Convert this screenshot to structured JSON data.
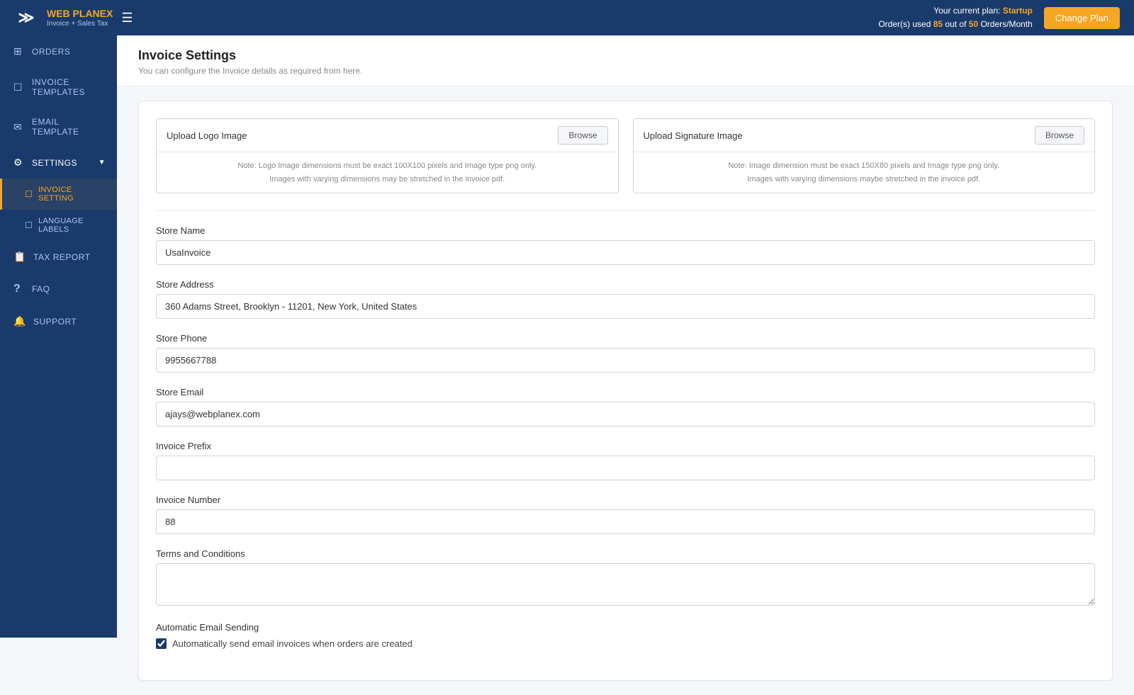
{
  "header": {
    "logo_brand": "WEB PLANEX",
    "logo_sub": "Invoice + Sales Tax",
    "plan_text": "Your current plan:",
    "plan_name": "Startup",
    "orders_used": "85",
    "orders_total": "50",
    "orders_label": "Orders/Month",
    "change_plan_btn": "Change Plan",
    "hamburger": "☰"
  },
  "sidebar": {
    "items": [
      {
        "id": "orders",
        "label": "ORDERS",
        "icon": "⊞"
      },
      {
        "id": "invoice-templates",
        "label": "INVOICE TEMPLATES",
        "icon": "☐"
      },
      {
        "id": "email-template",
        "label": "EMAIL TEMPLATE",
        "icon": "✉"
      },
      {
        "id": "settings",
        "label": "SETTINGS",
        "icon": "⚙",
        "expanded": true,
        "chevron": "▼"
      }
    ],
    "sub_items": [
      {
        "id": "invoice-setting",
        "label": "INVOICE SETTING",
        "icon": "☐",
        "active": true
      },
      {
        "id": "language-labels",
        "label": "LANGUAGE LABELS",
        "icon": "☐"
      }
    ],
    "bottom_items": [
      {
        "id": "tax-report",
        "label": "TAX REPORT",
        "icon": "📋"
      },
      {
        "id": "faq",
        "label": "FAQ",
        "icon": "?"
      },
      {
        "id": "support",
        "label": "SUPPORT",
        "icon": "🔔"
      }
    ]
  },
  "page": {
    "title": "Invoice Settings",
    "subtitle": "You can configure the Invoice details as required from here."
  },
  "upload": {
    "logo_label": "Upload Logo Image",
    "logo_note_line1": "Note: Logo Image dimensions must be exact 100X100 pixels and Image type png only.",
    "logo_note_line2": "Images with varying dimensions may be stretched in the invoice pdf.",
    "logo_browse": "Browse",
    "sig_label": "Upload Signature Image",
    "sig_note_line1": "Note: Image dimension must be exact 150X80 pixels and Image type png only.",
    "sig_note_line2": "Images with varying dimensions maybe stretched in the invoice pdf.",
    "sig_browse": "Browse"
  },
  "form": {
    "store_name_label": "Store Name",
    "store_name_value": "UsaInvoice",
    "store_address_label": "Store Address",
    "store_address_value": "360 Adams Street, Brooklyn - 11201, New York, United States",
    "store_phone_label": "Store Phone",
    "store_phone_value": "9955667788",
    "store_email_label": "Store Email",
    "store_email_value": "ajays@webplanex.com",
    "invoice_prefix_label": "Invoice Prefix",
    "invoice_prefix_value": "",
    "invoice_number_label": "Invoice Number",
    "invoice_number_value": "88",
    "terms_label": "Terms and Conditions",
    "terms_value": "",
    "auto_email_label": "Automatic Email Sending",
    "auto_email_checkbox_label": "Automatically send email invoices when orders are created"
  }
}
